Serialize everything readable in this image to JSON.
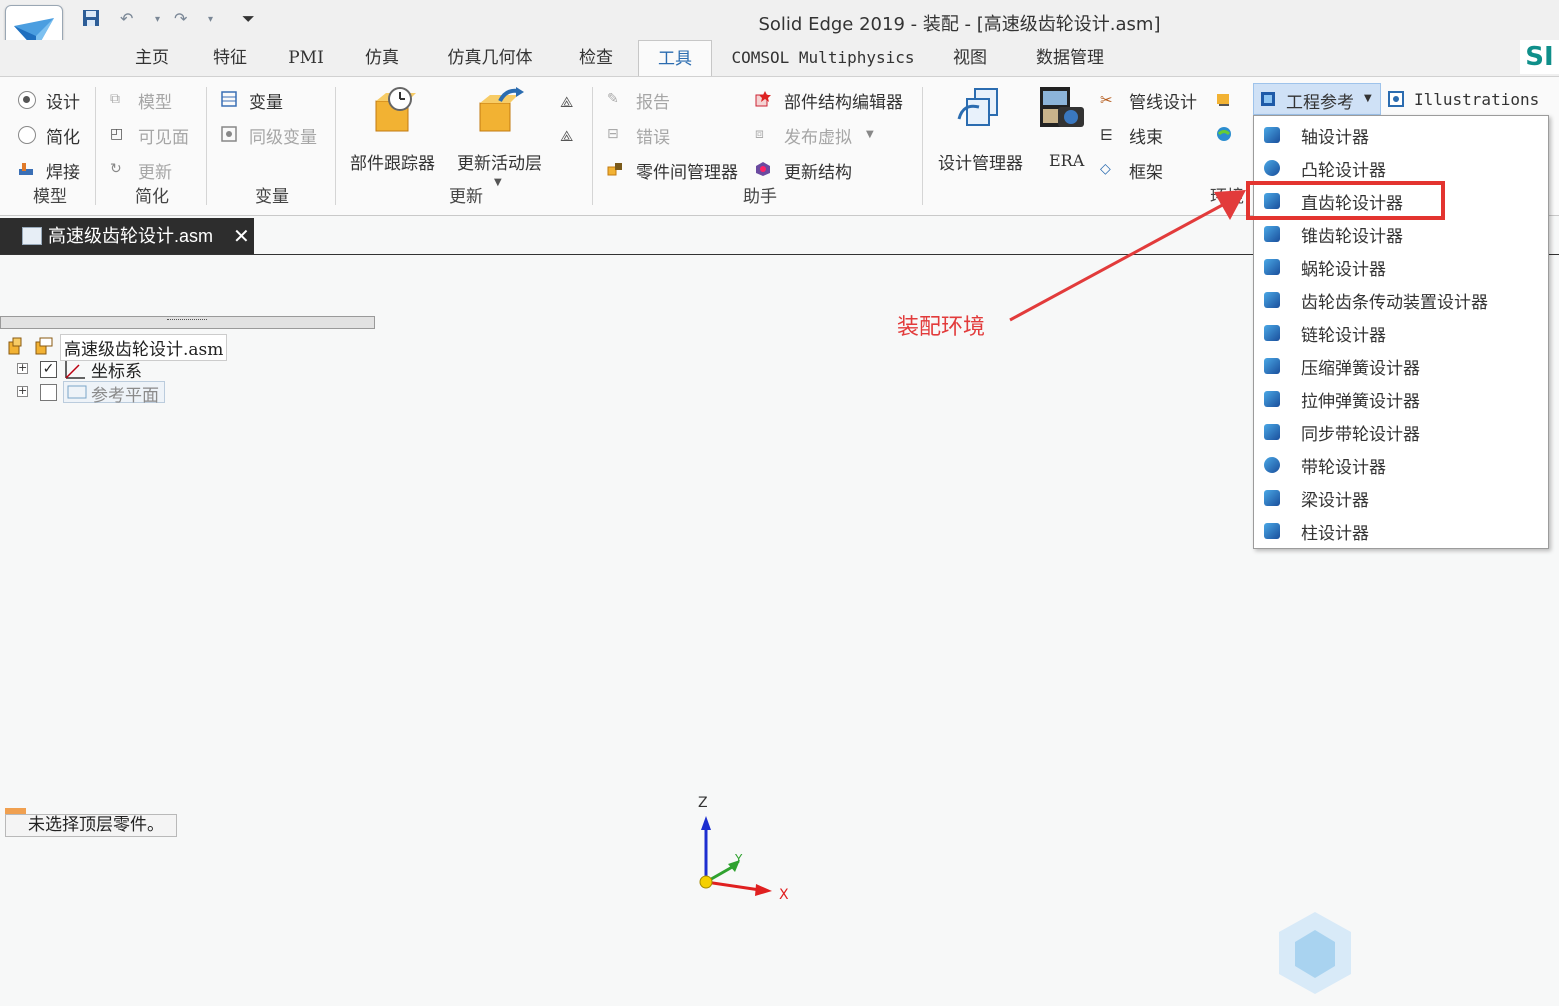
{
  "window": {
    "title": "Solid Edge 2019 - 装配 - [高速级齿轮设计.asm]"
  },
  "brand": "SI",
  "tabs": [
    "主页",
    "特征",
    "PMI",
    "仿真",
    "仿真几何体",
    "检查",
    "工具",
    "COMSOL Multiphysics",
    "视图",
    "数据管理"
  ],
  "active_tab": "工具",
  "ribbon": {
    "model": {
      "design": "设计",
      "simplify": "简化",
      "weld": "焊接",
      "group": "模型"
    },
    "simplify": {
      "model": "模型",
      "visible": "可见面",
      "update": "更新",
      "group": "简化"
    },
    "variables": {
      "vars": "变量",
      "peer": "同级变量",
      "group": "变量"
    },
    "update": {
      "tracker": "部件跟踪器",
      "active_layer": "更新活动层",
      "group": "更新"
    },
    "assistant": {
      "report": "报告",
      "errors": "错误",
      "inter_part": "零件间管理器",
      "structure_editor": "部件结构编辑器",
      "publish_virtual": "发布虚拟",
      "update_structure": "更新结构",
      "group": "助手"
    },
    "env": {
      "design_manager": "设计管理器",
      "era": "ERA",
      "piping": "管线设计",
      "harness": "线束",
      "frame": "框架",
      "group": "环境"
    },
    "eng_ref": "工程参考",
    "illustrations": "Illustrations"
  },
  "document_tab": "高速级齿轮设计.asm",
  "tree": {
    "root": "高速级齿轮设计.asm",
    "children": [
      "坐标系",
      "参考平面"
    ]
  },
  "dropdown": [
    "轴设计器",
    "凸轮设计器",
    "直齿轮设计器",
    "锥齿轮设计器",
    "蜗轮设计器",
    "齿轮齿条传动装置设计器",
    "链轮设计器",
    "压缩弹簧设计器",
    "拉伸弹簧设计器",
    "同步带轮设计器",
    "带轮设计器",
    "梁设计器",
    "柱设计器"
  ],
  "highlighted_item": "直齿轮设计器",
  "annotation": "装配环境",
  "status": "未选择顶层零件。",
  "triad": {
    "x": "X",
    "y": "Y",
    "z": "Z"
  },
  "colors": {
    "annotation": "#e23b3b",
    "active_tab": "#2b6cb0",
    "brand": "#0f8f8a"
  }
}
